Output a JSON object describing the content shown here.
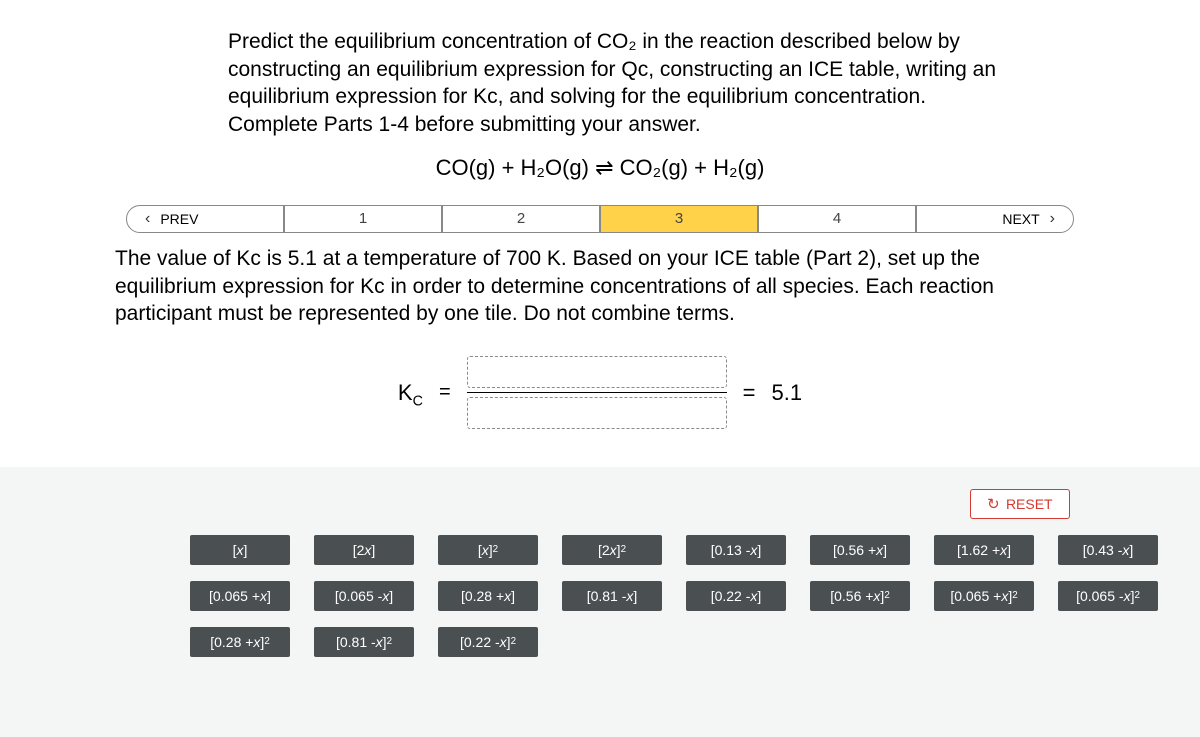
{
  "instructions": "Predict the equilibrium concentration of CO₂ in the reaction described below by constructing an equilibrium expression for Qc, constructing an ICE table, writing an equilibrium expression for Kc, and solving for the equilibrium concentration. Complete Parts 1-4 before submitting your answer.",
  "reaction_equation": "CO(g) + H₂O(g) ⇌ CO₂(g) + H₂(g)",
  "nav": {
    "prev": "PREV",
    "next": "NEXT",
    "steps": [
      "1",
      "2",
      "3",
      "4"
    ],
    "active_step": 3
  },
  "step3_instructions": "The value of Kc is 5.1 at a temperature of 700 K. Based on your ICE table (Part 2), set up the equilibrium expression for Kc in order to determine concentrations of all species. Each reaction participant must be represented by one tile. Do not combine terms.",
  "kc": {
    "label": "K",
    "sub": "C",
    "equals": "=",
    "result_equals": "=",
    "value": "5.1"
  },
  "reset": "RESET",
  "tiles": {
    "row1": [
      "[x]",
      "[2x]",
      "[x]²",
      "[2x]²",
      "[0.13 - x]",
      "[0.56 + x]",
      "[1.62 + x]",
      "[0.43 - x]"
    ],
    "row2": [
      "[0.065 + x]",
      "[0.065 - x]",
      "[0.28 + x]",
      "[0.81 - x]",
      "[0.22 - x]",
      "[0.56 + x]²",
      "[0.065 + x]²",
      "[0.065 - x]²"
    ],
    "row3": [
      "[0.28 + x]²",
      "[0.81 - x]²",
      "[0.22 - x]²"
    ]
  }
}
